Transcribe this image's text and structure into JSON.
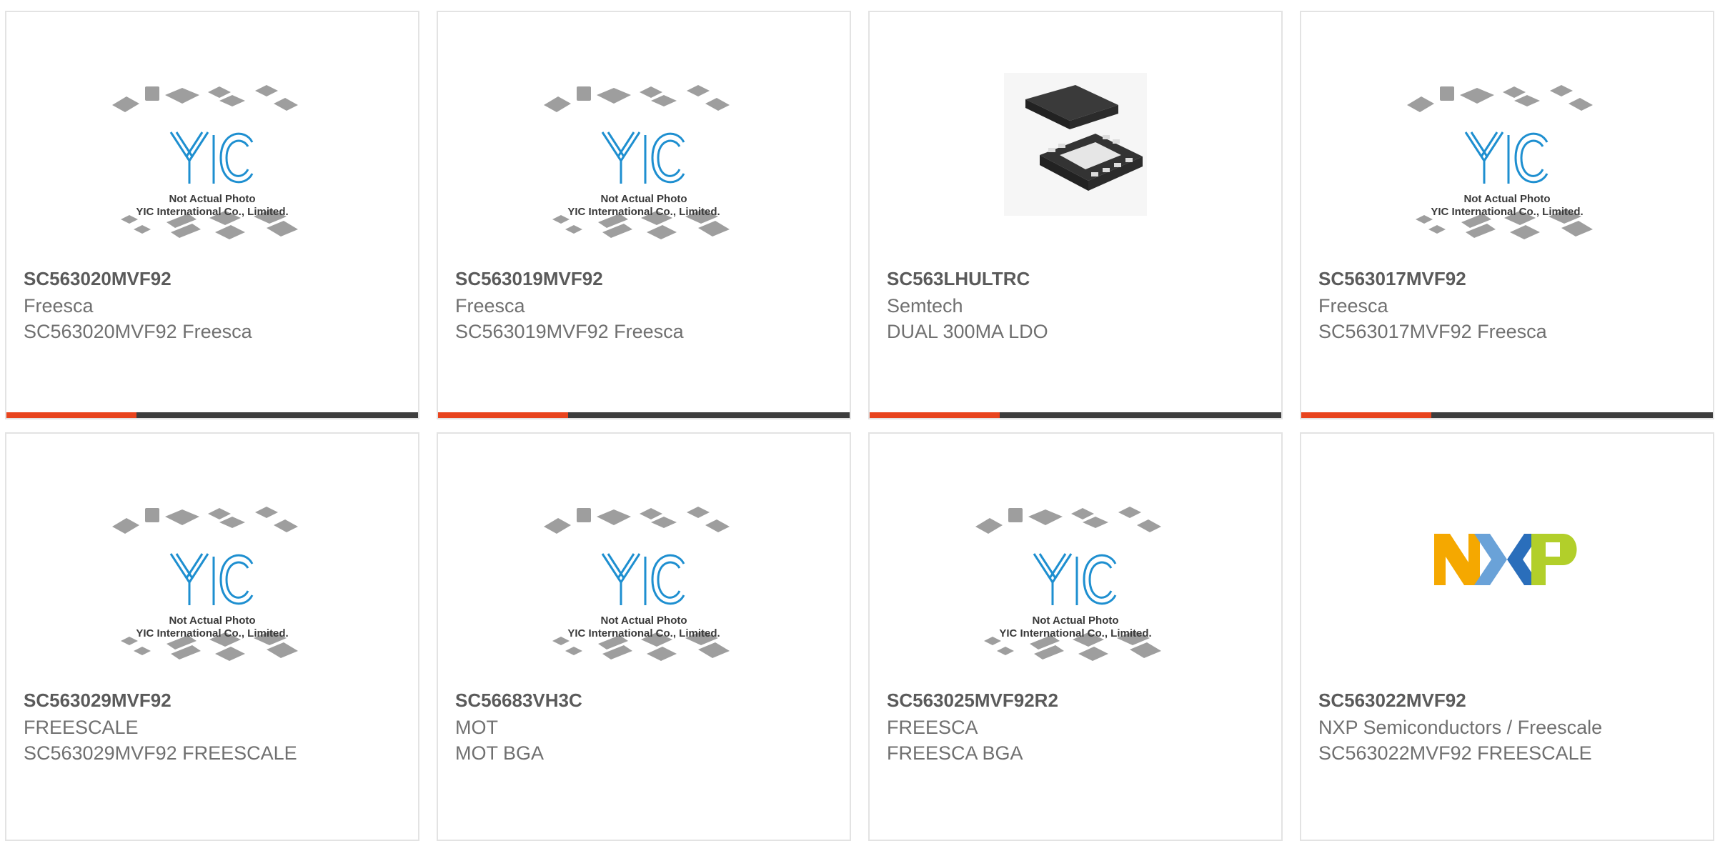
{
  "placeholder": {
    "line1": "Not Actual Photo",
    "line2": "YIC International Co., Limited.",
    "logo_text": "YIC"
  },
  "colors": {
    "accent": "#e8441e",
    "bar": "#3d3d3d",
    "yic_blue": "#1e8fd0"
  },
  "products": [
    {
      "part": "SC563020MVF92",
      "manufacturer": "Freesca",
      "description": "SC563020MVF92 Freesca",
      "image": "yic-placeholder"
    },
    {
      "part": "SC563019MVF92",
      "manufacturer": "Freesca",
      "description": "SC563019MVF92 Freesca",
      "image": "yic-placeholder"
    },
    {
      "part": "SC563LHULTRC",
      "manufacturer": "Semtech",
      "description": "DUAL 300MA LDO",
      "image": "chip-photo"
    },
    {
      "part": "SC563017MVF92",
      "manufacturer": "Freesca",
      "description": "SC563017MVF92 Freesca",
      "image": "yic-placeholder"
    },
    {
      "part": "SC563029MVF92",
      "manufacturer": "FREESCALE",
      "description": "SC563029MVF92 FREESCALE",
      "image": "yic-placeholder"
    },
    {
      "part": "SC56683VH3C",
      "manufacturer": "MOT",
      "description": "MOT BGA",
      "image": "yic-placeholder"
    },
    {
      "part": "SC563025MVF92R2",
      "manufacturer": "FREESCA",
      "description": "FREESCA BGA",
      "image": "yic-placeholder"
    },
    {
      "part": "SC563022MVF92",
      "manufacturer": "NXP Semiconductors / Freescale",
      "description": "SC563022MVF92 FREESCALE",
      "image": "nxp-logo"
    }
  ]
}
